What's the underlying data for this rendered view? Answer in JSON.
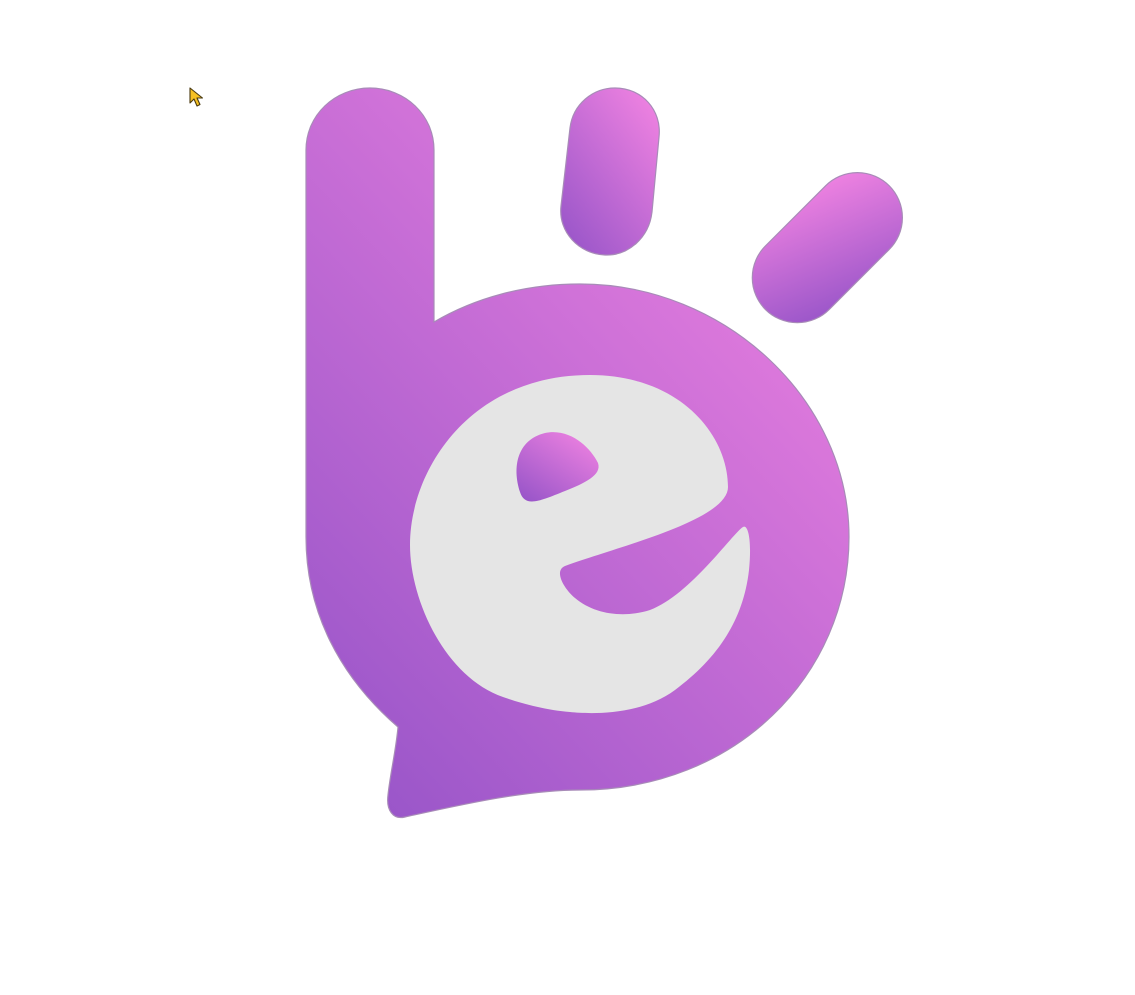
{
  "canvas": {
    "background_color": "#ffffff"
  },
  "logo": {
    "icon_name": "be-logo-icon",
    "gradient_start_color": "#f384e2",
    "gradient_end_color": "#9a56c9",
    "letter_color": "#e5e5e5"
  },
  "pointer": {
    "icon_name": "mouse-cursor-icon",
    "color": "#f5c022"
  }
}
